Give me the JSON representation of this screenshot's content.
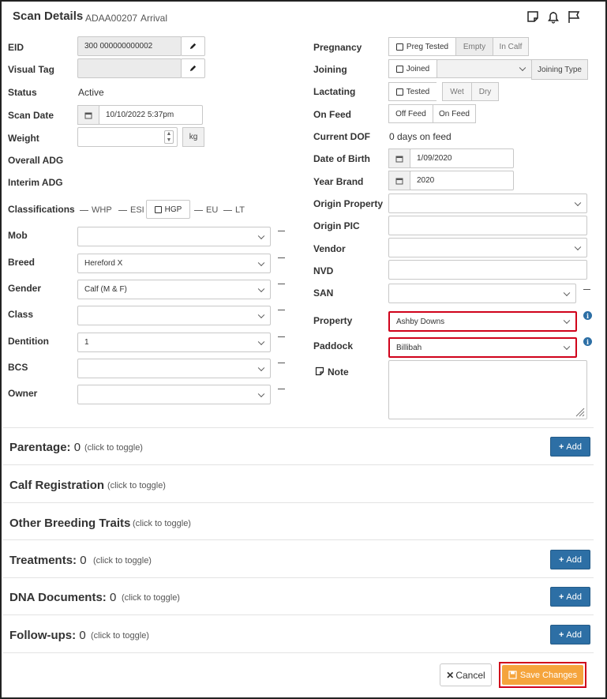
{
  "header": {
    "title": "Scan Details",
    "scan_id": "ADAA00207",
    "scan_type": "Arrival",
    "icons": [
      "note-icon",
      "bell-icon",
      "flag-icon"
    ]
  },
  "left": {
    "eid": {
      "label": "EID",
      "value": "300 000000000002"
    },
    "visual_tag": {
      "label": "Visual Tag",
      "value": ""
    },
    "status": {
      "label": "Status",
      "value": "Active"
    },
    "scan_date": {
      "label": "Scan Date",
      "value": "10/10/2022 5:37pm"
    },
    "weight": {
      "label": "Weight",
      "value": "",
      "unit": "kg"
    },
    "overall_adg": {
      "label": "Overall ADG"
    },
    "interim_adg": {
      "label": "Interim ADG"
    },
    "classifications": {
      "label": "Classifications",
      "whp": "WHP",
      "esi": "ESI",
      "hgp": "HGP",
      "eu": "EU",
      "lt": "LT"
    },
    "mob": {
      "label": "Mob",
      "value": ""
    },
    "breed": {
      "label": "Breed",
      "value": "Hereford X"
    },
    "gender": {
      "label": "Gender",
      "value": "Calf (M & F)"
    },
    "class": {
      "label": "Class",
      "value": ""
    },
    "dentition": {
      "label": "Dentition",
      "value": "1"
    },
    "bcs": {
      "label": "BCS",
      "value": ""
    },
    "owner": {
      "label": "Owner",
      "value": ""
    }
  },
  "right": {
    "pregnancy": {
      "label": "Pregnancy",
      "preg_tested": "Preg Tested",
      "empty": "Empty",
      "in_calf": "In Calf"
    },
    "joining": {
      "label": "Joining",
      "joined": "Joined",
      "joining_type": "Joining Type"
    },
    "lactating": {
      "label": "Lactating",
      "tested": "Tested",
      "wet": "Wet",
      "dry": "Dry"
    },
    "on_feed": {
      "label": "On Feed",
      "off_feed": "Off Feed",
      "on_feed_btn": "On Feed"
    },
    "current_dof": {
      "label": "Current DOF",
      "value": "0 days on feed"
    },
    "dob": {
      "label": "Date of Birth",
      "value": "1/09/2020"
    },
    "year_brand": {
      "label": "Year Brand",
      "value": "2020"
    },
    "origin_property": {
      "label": "Origin Property",
      "value": ""
    },
    "origin_pic": {
      "label": "Origin PIC",
      "value": ""
    },
    "vendor": {
      "label": "Vendor",
      "value": ""
    },
    "nvd": {
      "label": "NVD",
      "value": ""
    },
    "san": {
      "label": "SAN",
      "value": ""
    },
    "property": {
      "label": "Property",
      "value": "Ashby Downs"
    },
    "paddock": {
      "label": "Paddock",
      "value": "Billibah"
    },
    "note": {
      "label": "Note",
      "value": ""
    }
  },
  "sections": [
    {
      "title": "Parentage:",
      "count": "0",
      "hint": "(click to toggle)",
      "add": "Add"
    },
    {
      "title": "Calf Registration",
      "count": "",
      "hint": "(click to toggle)",
      "add": ""
    },
    {
      "title": "Other Breeding Traits",
      "count": "",
      "hint": "(click to toggle)",
      "add": ""
    },
    {
      "title": "Treatments:",
      "count": "0",
      "hint": "(click to toggle)",
      "add": "Add"
    },
    {
      "title": "DNA Documents:",
      "count": "0",
      "hint": "(click to toggle)",
      "add": "Add"
    },
    {
      "title": "Follow-ups:",
      "count": "0",
      "hint": "(click to toggle)",
      "add": "Add"
    }
  ],
  "footer": {
    "cancel": "Cancel",
    "save": "Save Changes"
  },
  "colors": {
    "primary": "#2d6fa5",
    "save": "#f5a43c",
    "highlight": "#d0021b"
  }
}
